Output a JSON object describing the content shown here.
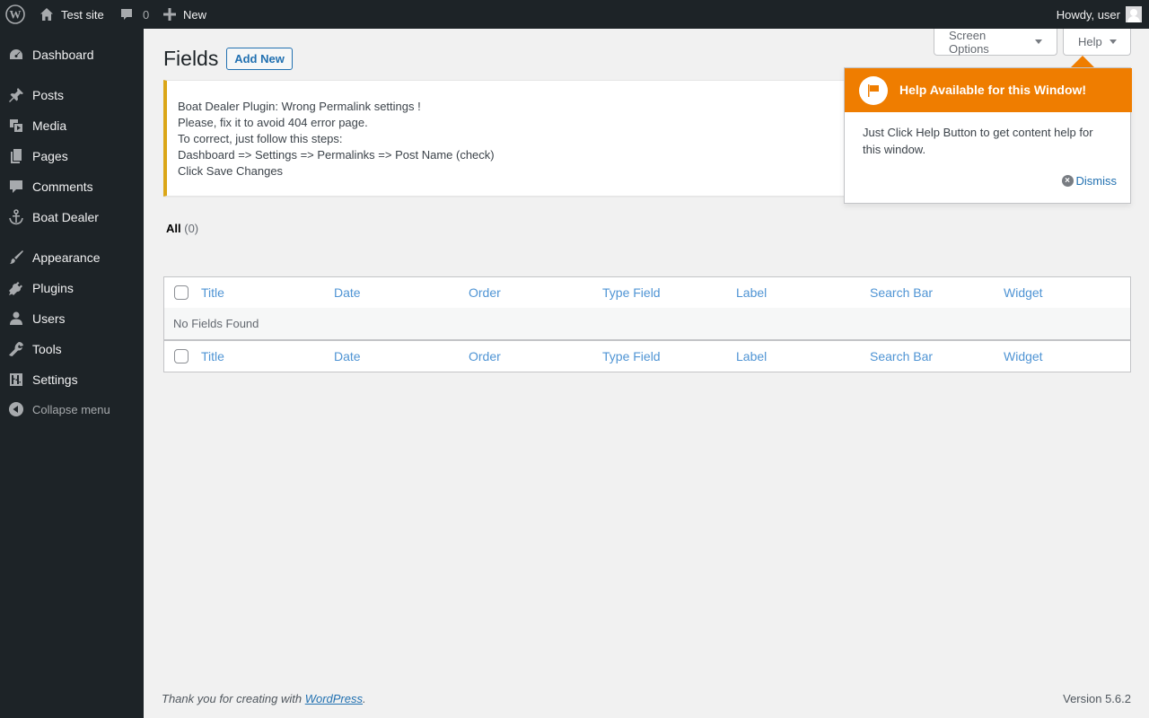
{
  "adminbar": {
    "site_name": "Test site",
    "comments_count": "0",
    "new_label": "New",
    "howdy": "Howdy, user"
  },
  "sidebar": {
    "items": [
      {
        "label": "Dashboard",
        "icon": "dashboard-icon"
      },
      {
        "label": "Posts",
        "icon": "pin-icon"
      },
      {
        "label": "Media",
        "icon": "media-icon"
      },
      {
        "label": "Pages",
        "icon": "pages-icon"
      },
      {
        "label": "Comments",
        "icon": "comment-icon"
      },
      {
        "label": "Boat Dealer",
        "icon": "anchor-icon"
      },
      {
        "label": "Appearance",
        "icon": "brush-icon"
      },
      {
        "label": "Plugins",
        "icon": "plugin-icon"
      },
      {
        "label": "Users",
        "icon": "user-icon"
      },
      {
        "label": "Tools",
        "icon": "wrench-icon"
      },
      {
        "label": "Settings",
        "icon": "settings-icon"
      }
    ],
    "collapse_label": "Collapse menu"
  },
  "header": {
    "screen_options": "Screen Options",
    "help": "Help",
    "title": "Fields",
    "add_new": "Add New"
  },
  "notice": {
    "lines": [
      "Boat Dealer Plugin: Wrong Permalink settings !",
      "Please, fix it to avoid 404 error page.",
      "To correct, just follow this steps:",
      "Dashboard => Settings => Permalinks => Post Name (check)",
      "Click Save Changes"
    ]
  },
  "filters": {
    "all_label": "All",
    "all_count": "(0)"
  },
  "table": {
    "columns": [
      "Title",
      "Date",
      "Order",
      "Type Field",
      "Label",
      "Search Bar",
      "Widget"
    ],
    "empty_message": "No Fields Found"
  },
  "pointer": {
    "title": "Help Available for this Window!",
    "body": "Just Click Help Button to get content help for this window.",
    "dismiss": "Dismiss",
    "color": "#ef7d00"
  },
  "footer": {
    "thanks_prefix": "Thank you for creating with ",
    "thanks_link": "WordPress",
    "thanks_suffix": ".",
    "version": "Version 5.6.2"
  }
}
